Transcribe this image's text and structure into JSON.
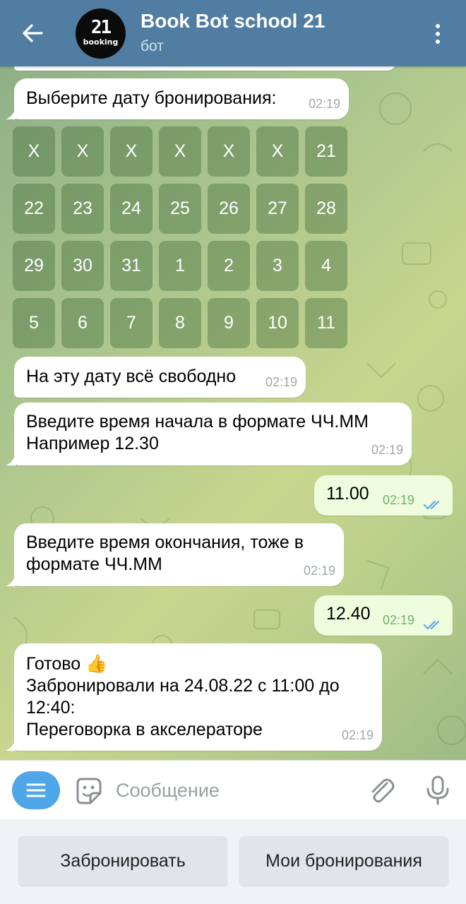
{
  "header": {
    "title": "Book Bot school 21",
    "subtitle": "бот",
    "avatar_logo": "21",
    "avatar_text": "booking"
  },
  "messages": [
    {
      "direction": "in",
      "text": "Выберите дату бронирования:",
      "time": "02:19"
    },
    {
      "direction": "in",
      "text": "На эту дату всё свободно",
      "time": "02:19"
    },
    {
      "direction": "in",
      "text": "Введите время начала в формате ЧЧ.ММ\nНапример 12.30",
      "time": "02:19"
    },
    {
      "direction": "out",
      "text": "11.00",
      "time": "02:19",
      "status": "read"
    },
    {
      "direction": "in",
      "text": "Введите время окончания, тоже в\nформате ЧЧ.ММ",
      "time": "02:19"
    },
    {
      "direction": "out",
      "text": "12.40",
      "time": "02:19",
      "status": "read"
    },
    {
      "direction": "in",
      "text": "Готово 👍\nЗабронировали на 24.08.22 с 11:00 до\n12:40:\nПереговорка в акселераторе",
      "time": "02:19"
    }
  ],
  "date_keyboard": [
    [
      "X",
      "X",
      "X",
      "X",
      "X",
      "X",
      "21"
    ],
    [
      "22",
      "23",
      "24",
      "25",
      "26",
      "27",
      "28"
    ],
    [
      "29",
      "30",
      "31",
      "1",
      "2",
      "3",
      "4"
    ],
    [
      "5",
      "6",
      "7",
      "8",
      "9",
      "10",
      "11"
    ]
  ],
  "input": {
    "placeholder": "Сообщение"
  },
  "reply_keyboard": {
    "buttons": [
      "Забронировать",
      "Мои бронирования"
    ]
  },
  "colors": {
    "header": "#517da2",
    "incoming_bubble": "#ffffff",
    "outgoing_bubble": "#effdde",
    "accent": "#4fa6e8"
  }
}
